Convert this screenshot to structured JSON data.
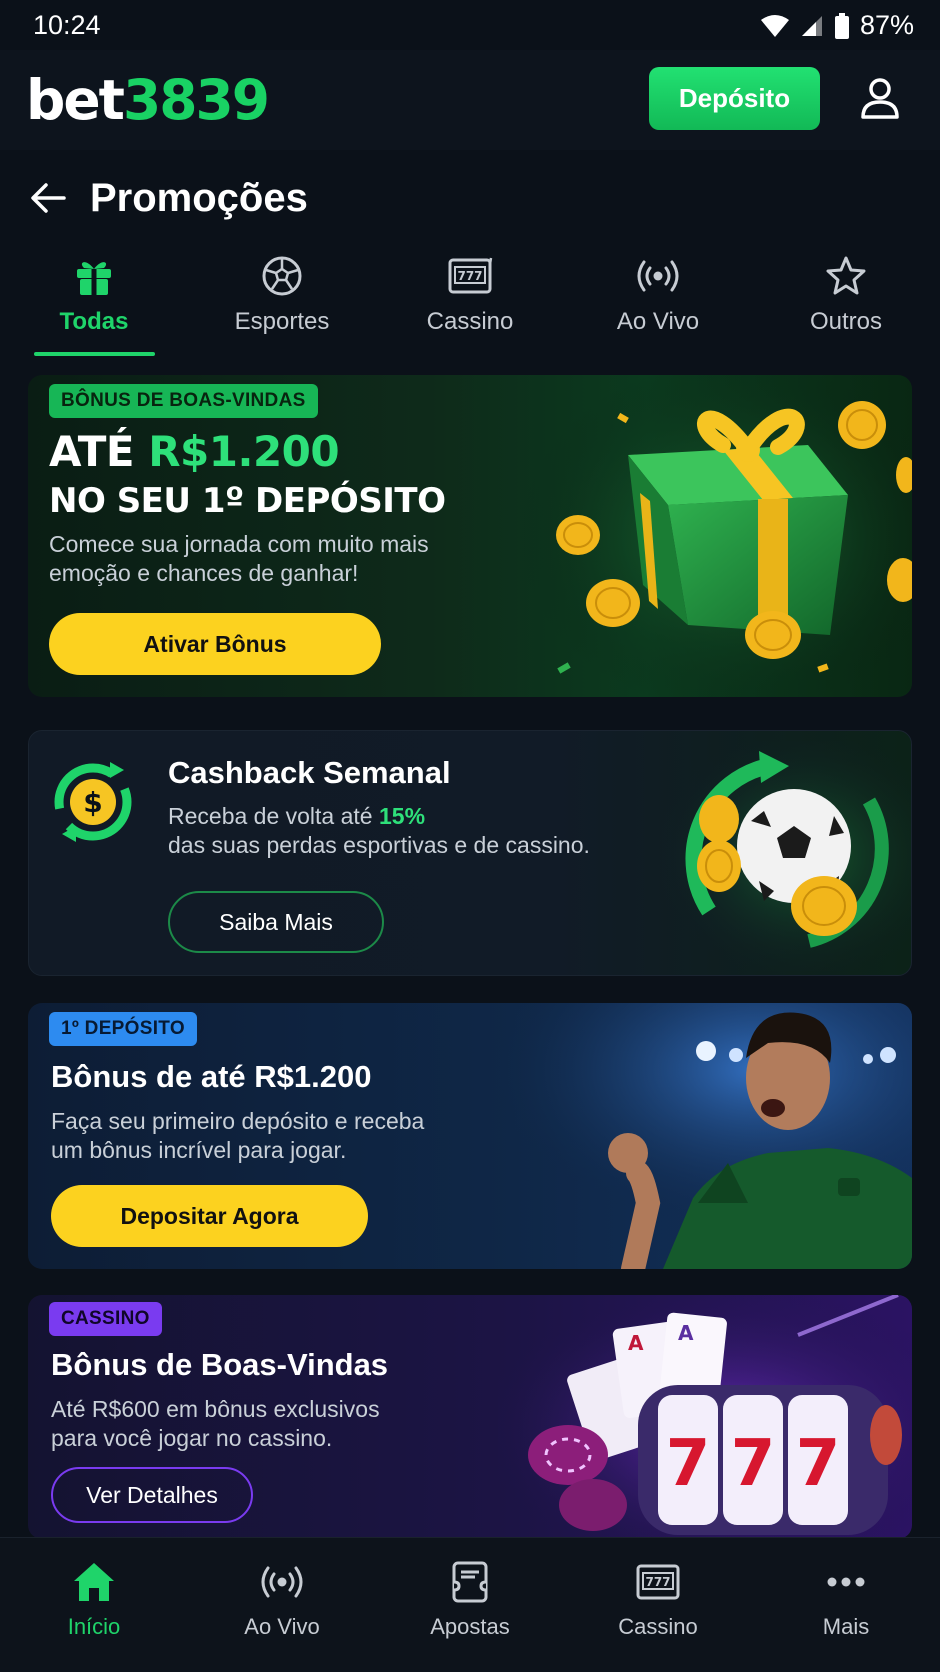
{
  "status_bar": {
    "time": "10:24",
    "battery": "87%"
  },
  "header": {
    "logo_part1": "bet",
    "logo_part2": "3839",
    "deposit_label": "Depósito"
  },
  "page": {
    "title": "Promoções"
  },
  "tabs": [
    {
      "label": "Todas",
      "icon": "gift-icon",
      "active": true
    },
    {
      "label": "Esportes",
      "icon": "soccer-ball-icon",
      "active": false
    },
    {
      "label": "Cassino",
      "icon": "slot-machine-icon",
      "active": false
    },
    {
      "label": "Ao Vivo",
      "icon": "live-broadcast-icon",
      "active": false
    },
    {
      "label": "Outros",
      "icon": "star-icon",
      "active": false
    }
  ],
  "promos": {
    "welcome": {
      "badge": "BÔNUS DE BOAS-VINDAS",
      "headline_prefix": "ATÉ ",
      "headline_amount": "R$1.200",
      "headline_line2": "NO SEU 1º DEPÓSITO",
      "desc_line1": "Comece sua jornada com muito mais",
      "desc_line2": "emoção e chances de ganhar!",
      "button": "Ativar Bônus"
    },
    "cashback": {
      "title": "Cashback Semanal",
      "desc_prefix": "Receba de volta até ",
      "desc_percent": "15%",
      "desc_line2": "das suas perdas esportivas e de cassino.",
      "button": "Saiba Mais"
    },
    "first_deposit": {
      "badge": "1º DEPÓSITO",
      "title": "Bônus de até R$1.200",
      "desc_line1": "Faça seu primeiro depósito e receba",
      "desc_line2": "um bônus incrível para jogar.",
      "button": "Depositar Agora"
    },
    "casino": {
      "badge": "CASSINO",
      "title": "Bônus de Boas-Vindas",
      "desc_line1": "Até R$600 em bônus exclusivos",
      "desc_line2": "para você jogar no cassino.",
      "button": "Ver Detalhes"
    }
  },
  "bottom_nav": [
    {
      "label": "Início",
      "icon": "home-icon",
      "active": true
    },
    {
      "label": "Ao Vivo",
      "icon": "live-broadcast-icon",
      "active": false
    },
    {
      "label": "Apostas",
      "icon": "bet-slip-icon",
      "active": false
    },
    {
      "label": "Cassino",
      "icon": "slot-machine-icon",
      "active": false
    },
    {
      "label": "Mais",
      "icon": "more-icon",
      "active": false
    }
  ],
  "colors": {
    "accent_green": "#1fd46a",
    "button_yellow": "#fcd21f",
    "background": "#0b1119"
  }
}
